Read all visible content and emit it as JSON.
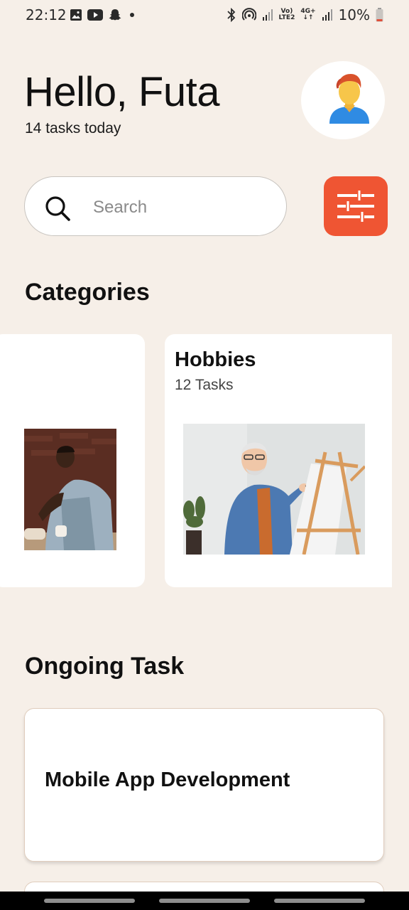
{
  "status_bar": {
    "time": "22:12",
    "battery": "10%",
    "net_line1": "Vo)",
    "net_line2": "LTE2",
    "net_4g": "4G+",
    "icons": [
      "image-icon",
      "youtube-icon",
      "snapchat-icon",
      "dot-icon",
      "bluetooth-icon",
      "hotspot-icon",
      "signal-icon",
      "signal-icon",
      "battery-icon"
    ]
  },
  "header": {
    "greeting": "Hello, Futa",
    "subtitle": "14 tasks today"
  },
  "search": {
    "placeholder": "Search"
  },
  "categories": {
    "title": "Categories",
    "cards": [
      {
        "title": "",
        "count": ""
      },
      {
        "title": "Hobbies",
        "count": "12 Tasks"
      }
    ]
  },
  "ongoing": {
    "title": "Ongoing Task",
    "tasks": [
      {
        "title": "Mobile App Development"
      }
    ]
  },
  "colors": {
    "background": "#f6efe8",
    "accent": "#ef5533",
    "card": "#ffffff"
  }
}
